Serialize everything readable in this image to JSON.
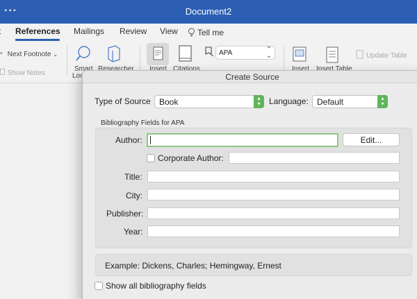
{
  "window": {
    "menu_icon": "more-dots-icon",
    "title": "Document2"
  },
  "tabs": [
    {
      "label": "t",
      "active": false
    },
    {
      "label": "References",
      "active": true
    },
    {
      "label": "Mailings",
      "active": false
    },
    {
      "label": "Review",
      "active": false
    },
    {
      "label": "View",
      "active": false
    },
    {
      "label": "Tell me",
      "icon": "lightbulb-icon",
      "active": false
    }
  ],
  "ribbon": {
    "next_footnote": "Next Footnote",
    "show_notes": "Show Notes",
    "smart_lookup_1": "Smart",
    "smart_lookup_2": "Loo",
    "researcher": "Researcher",
    "insert_citation": "Insert",
    "citations": "Citations",
    "style_value": "APA",
    "insert_caption": "Insert",
    "insert_table": "Insert Table",
    "update_table": "Update Table"
  },
  "dialog": {
    "title": "Create Source",
    "type_of_source_label": "Type of Source",
    "type_of_source_value": "Book",
    "language_label": "Language:",
    "language_value": "Default",
    "fields_group_title": "Bibliography Fields for APA",
    "author_label": "Author:",
    "author_value": "",
    "edit_button": "Edit...",
    "corporate_author_label": "Corporate Author:",
    "corporate_author_value": "",
    "title_label": "Title:",
    "title_value": "",
    "city_label": "City:",
    "city_value": "",
    "publisher_label": "Publisher:",
    "publisher_value": "",
    "year_label": "Year:",
    "year_value": "",
    "example_text": "Example: Dickens, Charles; Hemingway, Ernest",
    "show_all_label": "Show all bibliography fields"
  },
  "colors": {
    "title_bar": "#2c5fb3",
    "tab_underline": "#2b5fb1",
    "stepper_green": "#5fb65a",
    "focus_ring": "#93c58a"
  }
}
